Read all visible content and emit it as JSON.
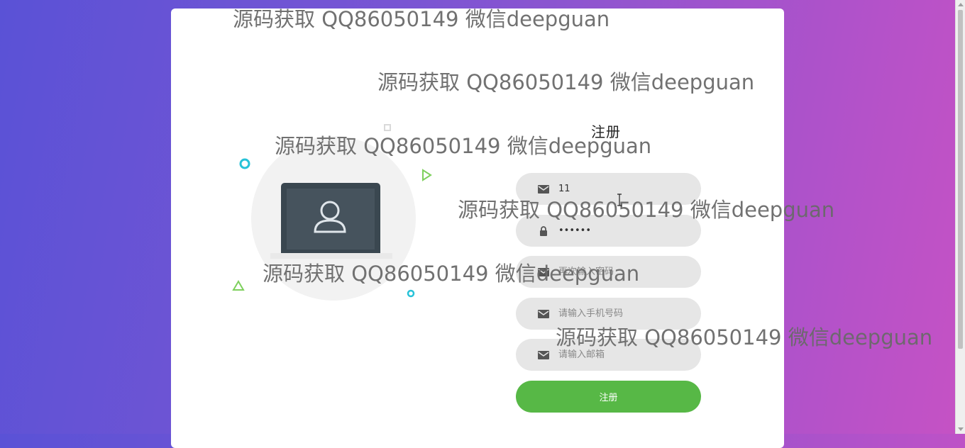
{
  "form": {
    "title": "注册",
    "fields": [
      {
        "icon": "envelope-icon",
        "value": "11",
        "placeholder": "",
        "type": "text"
      },
      {
        "icon": "lock-icon",
        "value": "123456",
        "placeholder": "",
        "type": "password"
      },
      {
        "icon": "envelope-icon",
        "value": "",
        "placeholder": "再次输入密码",
        "type": "text"
      },
      {
        "icon": "envelope-icon",
        "value": "",
        "placeholder": "请输入手机号码",
        "type": "text"
      },
      {
        "icon": "envelope-icon",
        "value": "",
        "placeholder": "请输入邮箱",
        "type": "text"
      }
    ],
    "submit_label": "注册"
  },
  "watermarks": [
    "源码获取 QQ86050149 微信deepguan",
    "源码获取 QQ86050149 微信deepguan",
    "源码获取 QQ86050149 微信deepguan",
    "源码获取 QQ86050149 微信deepguan",
    "源码获取 QQ86050149 微信deepguan",
    "源码获取 QQ86050149 微信deepguan"
  ],
  "colors": {
    "accent": "#57b846",
    "field_bg": "#e6e6e6",
    "gradient_start": "#5a52d6",
    "gradient_end": "#c652c4"
  }
}
